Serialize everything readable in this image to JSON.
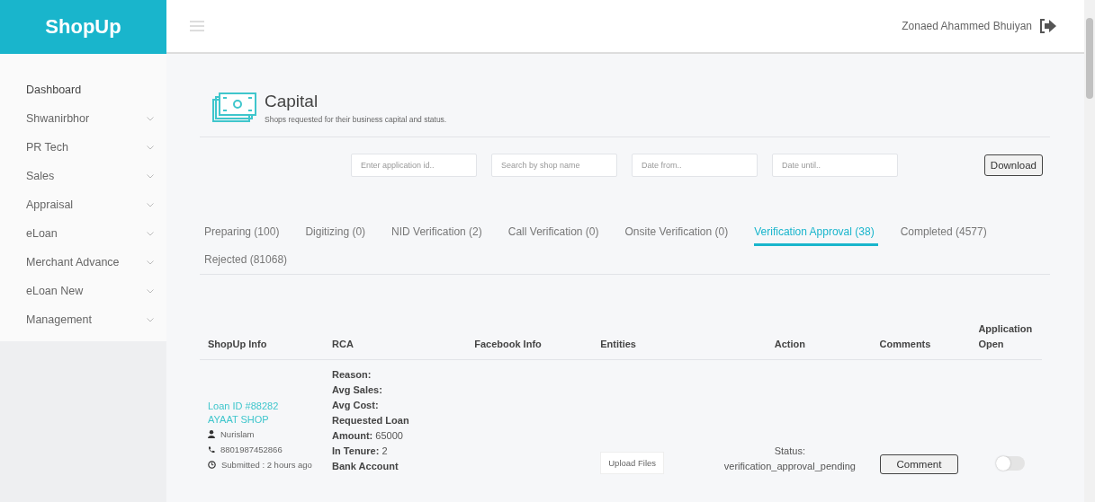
{
  "brand": "ShopUp",
  "user": {
    "name": "Zonaed Ahammed Bhuiyan"
  },
  "sidebar": {
    "items": [
      {
        "label": "Dashboard",
        "expandable": false
      },
      {
        "label": "Shwanirbhor",
        "expandable": true
      },
      {
        "label": "PR Tech",
        "expandable": true
      },
      {
        "label": "Sales",
        "expandable": true
      },
      {
        "label": "Appraisal",
        "expandable": true
      },
      {
        "label": "eLoan",
        "expandable": true
      },
      {
        "label": "Merchant Advance",
        "expandable": true
      },
      {
        "label": "eLoan New",
        "expandable": true
      },
      {
        "label": "Management",
        "expandable": true
      }
    ]
  },
  "page": {
    "title": "Capital",
    "subtitle": "Shops requested for their business capital and status."
  },
  "filters": [
    {
      "placeholder": "Enter application id.."
    },
    {
      "placeholder": "Search by shop name"
    },
    {
      "placeholder": "Date from.."
    },
    {
      "placeholder": "Date until.."
    }
  ],
  "download_button": "Download",
  "tabs": [
    {
      "label": "Preparing (100)",
      "selected": false
    },
    {
      "label": "Digitizing (0)",
      "selected": false
    },
    {
      "label": "NID Verification (2)",
      "selected": false
    },
    {
      "label": "Call Verification (0)",
      "selected": false
    },
    {
      "label": "Onsite Verification (0)",
      "selected": false
    },
    {
      "label": "Verification Approval (38)",
      "selected": true
    },
    {
      "label": "Completed (4577)",
      "selected": false
    },
    {
      "label": "Rejected (81068)",
      "selected": false
    }
  ],
  "table": {
    "columns": [
      "ShopUp Info",
      "RCA",
      "Facebook Info",
      "Entities",
      "Action",
      "Comments",
      "Application Open"
    ],
    "rows": [
      {
        "loan_id": "Loan ID #88282",
        "shop_name": "AYAAT SHOP",
        "owner": "Nurislam",
        "phone": "8801987452866",
        "submitted": "Submitted : 2 hours ago",
        "rca": [
          "**Reason:**",
          "**Avg Sales:**",
          "**Avg Cost:**",
          "**Requested Loan Amount:** 65000",
          "**In Tenure:** 2",
          "**Bank Account**"
        ],
        "upload_button": "Upload Files",
        "status": "Status: verification_approval_pending",
        "comment_button": "Comment",
        "application_open": false
      }
    ]
  }
}
